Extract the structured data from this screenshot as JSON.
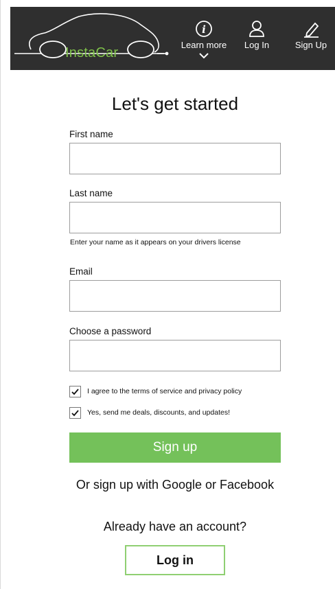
{
  "header": {
    "brand": "InstaCar",
    "brand_color": "#7fc24a",
    "background_color": "#2f2f2f",
    "nav": {
      "learn_more": {
        "label": "Learn more",
        "icon": "info-icon",
        "submenu_icon": "chevron-down-icon"
      },
      "log_in": {
        "label": "Log In",
        "icon": "user-icon"
      },
      "sign_up": {
        "label": "Sign Up",
        "icon": "pencil-icon"
      }
    }
  },
  "form": {
    "title": "Let's get started",
    "fields": {
      "first_name": {
        "label": "First name",
        "value": ""
      },
      "last_name": {
        "label": "Last name",
        "value": "",
        "hint": "Enter your name as it appears on your drivers license"
      },
      "email": {
        "label": "Email",
        "value": ""
      },
      "password": {
        "label": "Choose a password",
        "value": ""
      }
    },
    "checkboxes": {
      "terms": {
        "label": "I agree to the terms of service and privacy policy",
        "checked": true
      },
      "deals": {
        "label": "Yes, send me deals, discounts, and updates!",
        "checked": true
      }
    },
    "submit_label": "Sign up",
    "submit_color": "#74c15a",
    "social_text": "Or sign up with Google or Facebook",
    "existing_account_text": "Already have an account?",
    "login_label": "Log in",
    "login_border_color": "#8fcf72"
  }
}
